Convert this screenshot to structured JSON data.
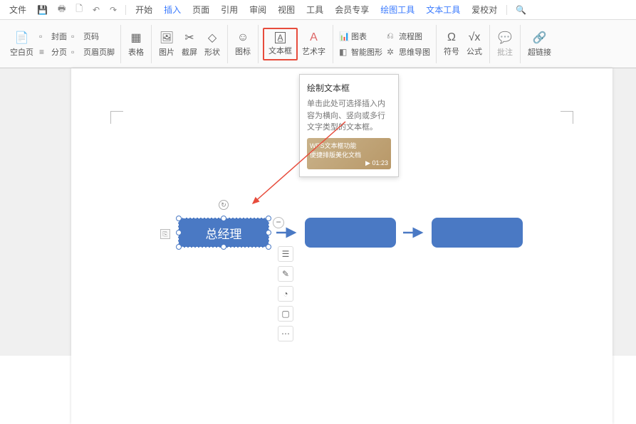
{
  "topbar": {
    "file": "文件",
    "tabs": [
      "开始",
      "插入",
      "页面",
      "引用",
      "审阅",
      "视图",
      "工具",
      "会员专享",
      "绘图工具",
      "文本工具",
      "爱校对"
    ],
    "active_tab": "插入"
  },
  "ribbon": {
    "group1": {
      "blank": "空白页",
      "cover": "封面",
      "break": "分页",
      "pagenum": "页码",
      "headfoot": "页眉页脚"
    },
    "group2": {
      "table": "表格"
    },
    "group3": {
      "pic": "图片",
      "screenshot": "截屏",
      "shapes": "形状"
    },
    "group4": {
      "icon": "图标"
    },
    "group5": {
      "textbox": "文本框",
      "wordart": "艺术字"
    },
    "group6": {
      "chart": "图表",
      "smartart": "智能图形",
      "flow": "流程图",
      "mind": "思维导图"
    },
    "group7": {
      "symbol": "符号",
      "formula": "公式"
    },
    "group8": {
      "comment": "批注"
    },
    "group9": {
      "link": "超链接"
    }
  },
  "tooltip": {
    "title": "绘制文本框",
    "body": "单击此处可选择插入内容为横向、竖向或多行文字类型的文本框。",
    "video_title": "WPS文本框功能\n便捷排版美化文档",
    "duration": "01:23"
  },
  "shapes": {
    "selected_text": "总经理"
  }
}
